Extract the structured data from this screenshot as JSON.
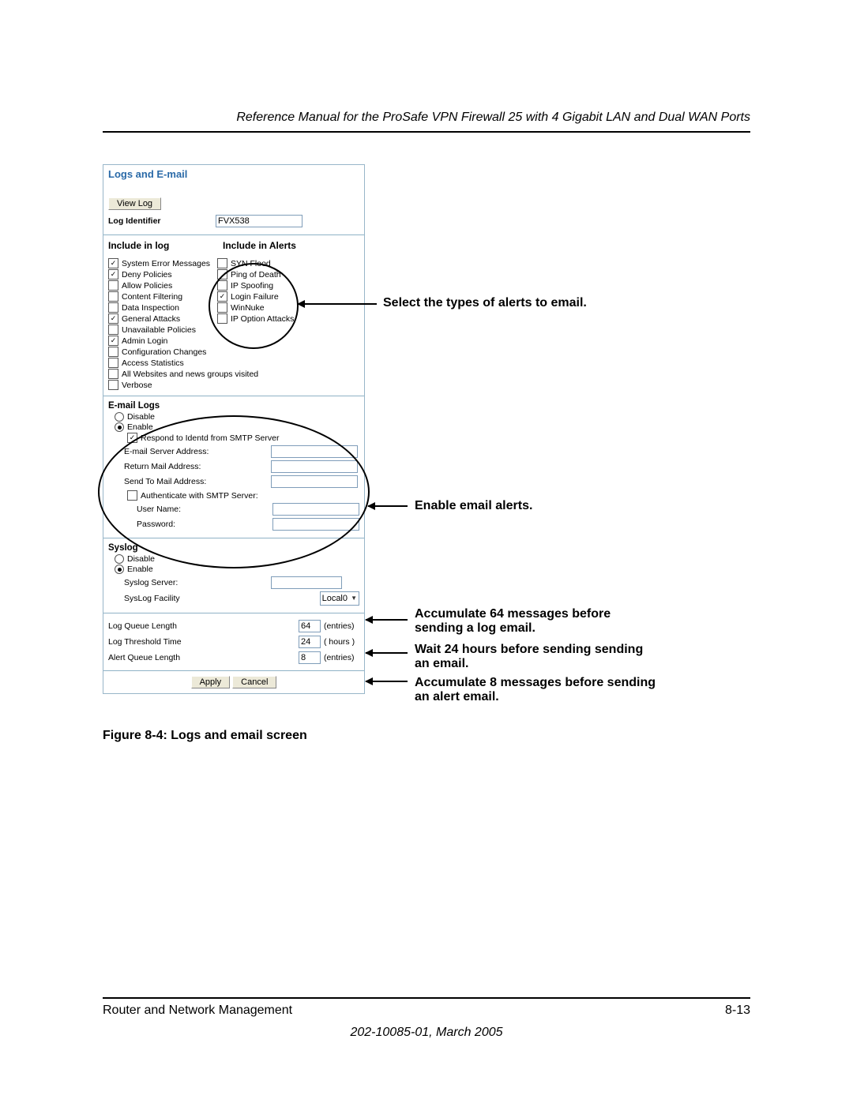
{
  "header": {
    "title": "Reference Manual for the ProSafe VPN Firewall 25 with 4 Gigabit LAN and Dual WAN Ports"
  },
  "panel": {
    "title": "Logs and E-mail",
    "view_log_btn": "View Log",
    "log_identifier_label": "Log Identifier",
    "log_identifier_value": "FVX538",
    "include_in_log_label": "Include in log",
    "include_in_alerts_label": "Include in Alerts",
    "log_checks": [
      {
        "label": "System Error Messages",
        "checked": true
      },
      {
        "label": "Deny Policies",
        "checked": true
      },
      {
        "label": "Allow Policies",
        "checked": false
      },
      {
        "label": "Content Filtering",
        "checked": false
      },
      {
        "label": "Data Inspection",
        "checked": false
      },
      {
        "label": "General Attacks",
        "checked": true
      },
      {
        "label": "Unavailable Policies",
        "checked": false
      },
      {
        "label": "Admin Login",
        "checked": true
      },
      {
        "label": "Configuration Changes",
        "checked": false
      },
      {
        "label": "Access Statistics",
        "checked": false
      },
      {
        "label": "All Websites and news groups visited",
        "checked": false
      },
      {
        "label": "Verbose",
        "checked": false
      }
    ],
    "alert_checks": [
      {
        "label": "SYN Flood",
        "checked": false
      },
      {
        "label": "Ping of Death",
        "checked": false
      },
      {
        "label": "IP Spoofing",
        "checked": false
      },
      {
        "label": "Login Failure",
        "checked": true
      },
      {
        "label": "WinNuke",
        "checked": false
      },
      {
        "label": "IP Option Attacks",
        "checked": false
      }
    ],
    "email_section_title": "E-mail Logs",
    "email_disable": "Disable",
    "email_enable": "Enable",
    "email_respond": "Respond to Identd from SMTP Server",
    "email_server_label": "E-mail Server Address:",
    "return_mail_label": "Return Mail Address:",
    "send_to_label": "Send To Mail Address:",
    "auth_label": "Authenticate with SMTP Server:",
    "user_label": "User Name:",
    "pass_label": "Password:",
    "syslog_title": "Syslog",
    "syslog_disable": "Disable",
    "syslog_enable": "Enable",
    "syslog_server_label": "Syslog Server:",
    "syslog_facility_label": "SysLog Facility",
    "syslog_facility_value": "Local0",
    "log_queue_label": "Log Queue Length",
    "log_queue_val": "64",
    "log_queue_unit": "(entries)",
    "log_threshold_label": "Log Threshold Time",
    "log_threshold_val": "24",
    "log_threshold_unit": "( hours )",
    "alert_queue_label": "Alert Queue Length",
    "alert_queue_val": "8",
    "alert_queue_unit": "(entries)",
    "apply_btn": "Apply",
    "cancel_btn": "Cancel"
  },
  "callouts": {
    "c1": "Select the types of alerts to email.",
    "c2": "Enable email alerts.",
    "c3a": "Accumulate 64 messages before sending a log email.",
    "c3b": "Wait 24 hours before sending sending an email.",
    "c3c": "Accumulate 8 messages before sending an alert email."
  },
  "figure_caption": "Figure 8-4:  Logs and email screen",
  "footer": {
    "left": "Router and Network Management",
    "right": "8-13",
    "docnum": "202-10085-01, March 2005"
  }
}
